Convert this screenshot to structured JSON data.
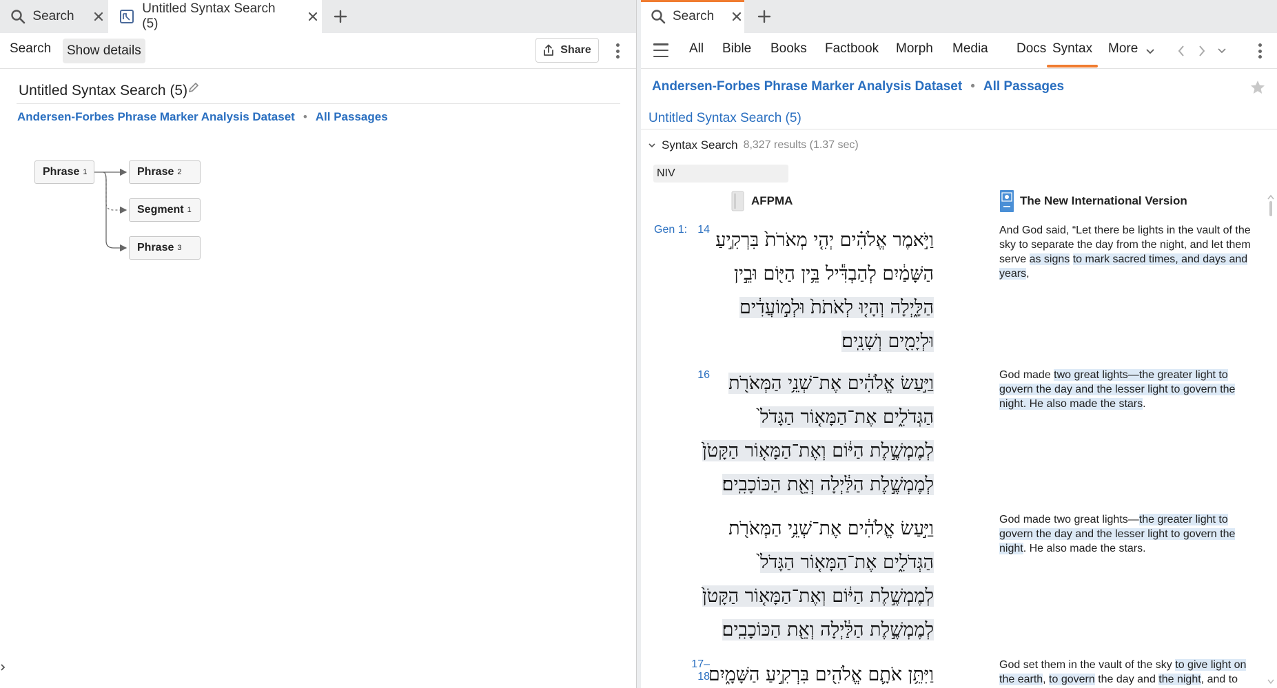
{
  "left_pane": {
    "tabs": [
      {
        "label": "Search",
        "icon": "search-icon"
      },
      {
        "label": "Untitled Syntax Search (5)",
        "icon": "syntax-search-icon"
      }
    ],
    "toolbar": {
      "search_label": "Search",
      "show_details_label": "Show details",
      "share_label": "Share"
    },
    "title": "Untitled Syntax Search (5)",
    "dataset_label": "Andersen-Forbes Phrase Marker Analysis Dataset",
    "passages_label": "All Passages",
    "diagram": {
      "nodes": [
        {
          "label": "Phrase",
          "sub": "1"
        },
        {
          "label": "Phrase",
          "sub": "2"
        },
        {
          "label": "Segment",
          "sub": "1"
        },
        {
          "label": "Phrase",
          "sub": "3"
        }
      ]
    }
  },
  "right_pane": {
    "tab": {
      "label": "Search",
      "icon": "search-icon"
    },
    "nav": [
      "All",
      "Bible",
      "Books",
      "Factbook",
      "Morph",
      "Media",
      "Docs",
      "Syntax",
      "More"
    ],
    "active_nav": "Syntax",
    "dataset_label": "Andersen-Forbes Phrase Marker Analysis Dataset",
    "passages_label": "All Passages",
    "search_title": "Untitled Syntax Search (5)",
    "syntax_section_label": "Syntax Search",
    "result_count": "8,327 results (1.37 sec)",
    "version_field": "NIV",
    "col_afpma": "AFPMA",
    "col_niv": "The New International Version",
    "results": [
      {
        "ref": "Gen 1:",
        "verse": "14",
        "hebrew": [
          [
            {
              "t": "וַיֹּ֣אמֶר אֱלֹהִ֗ים יְהִ֤י מְאֹרֹת֙ בִּרְקִ֣יעַ",
              "h": false
            }
          ],
          [
            {
              "t": "הַשָּׁמַ֔יִם לְהַבְדִּ֕יל בֵּ֥ין הַיּ֖וֹם וּבֵ֣ין",
              "h": false
            }
          ],
          [
            {
              "t": "הַלָּ֑יְלָה וְהָי֤וּ לְאֹתֹת֙ וּלְמ֣וֹעֲדִ֔ים",
              "h": true
            }
          ],
          [
            {
              "t": "וּלְיָמִ֖ים וְשָׁנִֽים׃",
              "h": true
            }
          ]
        ],
        "english": [
          {
            "t": "And God said, “Let there be lights in the vault of the sky to separate the day from the night, and let them serve ",
            "h": false
          },
          {
            "t": "as signs",
            "h": true
          },
          {
            "t": " ",
            "h": false
          },
          {
            "t": "to mark sacred times, and days and years",
            "h": true
          },
          {
            "t": ",",
            "h": false
          }
        ]
      },
      {
        "ref": "",
        "verse": "16",
        "hebrew": [
          [
            {
              "t": "וַיַּ֣עַשׂ אֱלֹהִ֔ים אֶת־שְׁנֵ֥י הַמְּאֹרֹ֖ת",
              "h": true
            }
          ],
          [
            {
              "t": "הַגְּדֹלִ֑ים אֶת־הַמָּא֤וֹר הַגָּדֹל֙",
              "h": true
            }
          ],
          [
            {
              "t": "לְמֶמְשֶׁ֣לֶת הַיּ֔וֹם וְאֶת־הַמָּא֤וֹר הַקָּטֹן֙",
              "h": true
            }
          ],
          [
            {
              "t": "לְמֶמְשֶׁ֣לֶת הַלַּ֔יְלָה וְאֵ֖ת הַכּוֹכָבִֽים׃",
              "h": true
            }
          ]
        ],
        "english": [
          {
            "t": "God made ",
            "h": false
          },
          {
            "t": "two great lights—the greater light to govern the day and the lesser light to govern the night. He also made the stars",
            "h": true
          },
          {
            "t": ".",
            "h": false
          }
        ]
      },
      {
        "ref": "",
        "verse": "",
        "hebrew": [
          [
            {
              "t": "וַיַּ֣עַשׂ אֱלֹהִ֔ים אֶת־שְׁנֵ֥י הַמְּאֹרֹ֖ת",
              "h": false
            }
          ],
          [
            {
              "t": "הַגְּדֹלִ֑ים אֶת־הַמָּא֤וֹר הַגָּדֹל֙",
              "h": true
            }
          ],
          [
            {
              "t": "לְמֶמְשֶׁ֣לֶת הַיּ֔וֹם וְאֶת־הַמָּא֤וֹר הַקָּטֹן֙",
              "h": true
            }
          ],
          [
            {
              "t": "לְמֶמְשֶׁ֣לֶת הַלַּ֔יְלָה וְאֵ֖ת הַכּוֹכָבִֽים׃",
              "h": true
            }
          ]
        ],
        "english": [
          {
            "t": "God made two great lights—",
            "h": false
          },
          {
            "t": "the greater light to govern the day and the lesser light to govern the night",
            "h": true
          },
          {
            "t": ". He also made the stars.",
            "h": false
          }
        ]
      },
      {
        "ref": "",
        "verse": "17–18",
        "hebrew": [
          [
            {
              "t": "וַיִּתֵּ֥ן אֹתָ֛ם אֱלֹהִ֖ים בִּרְקִ֣יעַ הַשָּׁמָ֑יִם",
              "h": false
            }
          ]
        ],
        "english": [
          {
            "t": "God set them in the vault of the sky ",
            "h": false
          },
          {
            "t": "to give light on the earth",
            "h": true
          },
          {
            "t": ", ",
            "h": false
          },
          {
            "t": "to govern",
            "h": true
          },
          {
            "t": " the day and ",
            "h": false
          },
          {
            "t": "the night",
            "h": true
          },
          {
            "t": ", and to",
            "h": false
          }
        ]
      }
    ]
  },
  "colors": {
    "accent": "#f07c30",
    "link": "#2a6fc0",
    "hebrew_highlight": "#e7eaee",
    "english_highlight": "#dce9f6"
  }
}
